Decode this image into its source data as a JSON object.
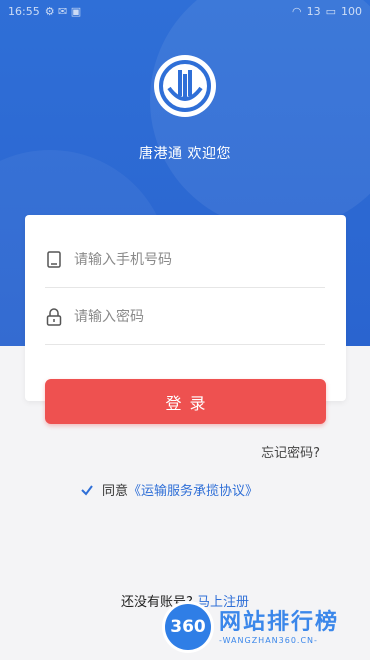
{
  "status_bar": {
    "time": "16:55",
    "signal": "13",
    "battery": "100"
  },
  "brand": {
    "welcome_text": "唐港通 欢迎您"
  },
  "form": {
    "phone_placeholder": "请输入手机号码",
    "password_placeholder": "请输入密码"
  },
  "actions": {
    "login_label": "登录",
    "forgot_label": "忘记密码?"
  },
  "agreement": {
    "checked": true,
    "prefix": "同意",
    "link": "《运输服务承揽协议》"
  },
  "register": {
    "question": "还没有账号?",
    "link": "马上注册"
  },
  "watermark": {
    "badge": "360",
    "name": "网站排行榜",
    "domain": "-WANGZHAN360.CN-"
  },
  "colors": {
    "primary_blue": "#2f6fd7",
    "login_red": "#ee5150",
    "background": "#f4f4f6"
  },
  "icons": [
    "phone-icon",
    "lock-icon",
    "checkbox-icon",
    "app-logo"
  ]
}
